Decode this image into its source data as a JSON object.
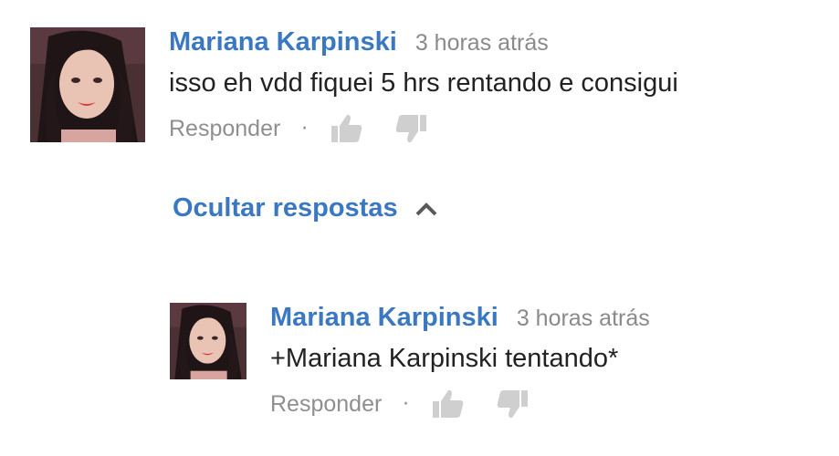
{
  "comments": [
    {
      "author": "Mariana Karpinski",
      "time": "3 horas atrás",
      "text": "isso eh vdd fiquei 5 hrs rentando e consigui",
      "reply_label": "Responder",
      "separator": "·"
    }
  ],
  "hide_replies_label": "Ocultar respostas",
  "replies": [
    {
      "author": "Mariana Karpinski",
      "time": "3 horas atrás",
      "text": "+Mariana Karpinski tentando*",
      "reply_label": "Responder",
      "separator": "·"
    }
  ],
  "icons": {
    "like": "thumbs-up-icon",
    "dislike": "thumbs-down-icon",
    "collapse": "chevron-up-icon"
  },
  "colors": {
    "link": "#3a78c2",
    "meta": "#8a8a8a",
    "text": "#222222",
    "icon": "#cfcfcf"
  }
}
